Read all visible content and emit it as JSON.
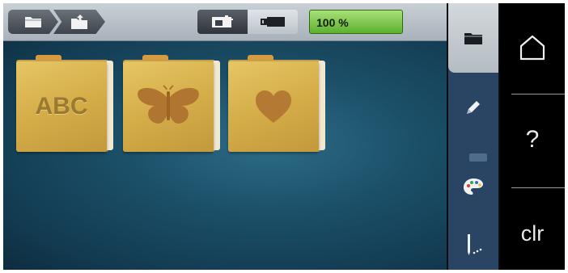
{
  "topbar": {
    "breadcrumbs": [
      {
        "name": "folder-icon"
      },
      {
        "name": "folder-open-icon"
      }
    ],
    "view_buttons": [
      {
        "name": "machine-icon",
        "selected": true
      },
      {
        "name": "memory-stick-icon",
        "selected": false
      }
    ],
    "zoom_label": "100 %",
    "zoom_color": "#5db12e"
  },
  "folders": [
    {
      "label": "ABC",
      "icon": null
    },
    {
      "label": "",
      "icon": "butterfly-icon"
    },
    {
      "label": "",
      "icon": "heart-icon"
    }
  ],
  "side_rail": {
    "items": [
      {
        "name": "folder-icon"
      },
      {
        "name": "pencil-icon"
      },
      {
        "name": "palette-icon"
      },
      {
        "name": "needle-icon"
      }
    ]
  },
  "right_panel": {
    "home_icon": "home-icon",
    "help_label": "?",
    "clear_label": "clr"
  }
}
